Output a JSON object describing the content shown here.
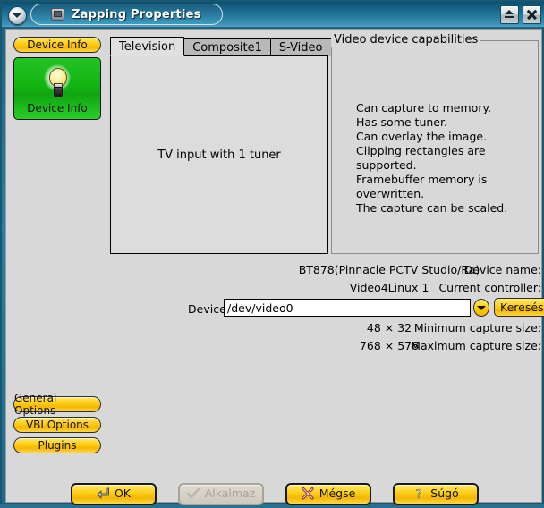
{
  "window": {
    "title": "Zapping Properties",
    "menu_icon": "chevron-down-icon",
    "app_icon": "tv-device-icon",
    "shade_button": "shade-icon",
    "close_button": "close-icon"
  },
  "sidebar": {
    "header_label": "Device Info",
    "active_panel": {
      "icon": "lightbulb-icon",
      "label": "Device Info"
    },
    "bottom_items": [
      {
        "label": "General Options"
      },
      {
        "label": "VBI Options"
      },
      {
        "label": "Plugins"
      }
    ]
  },
  "main": {
    "tabs": [
      {
        "label": "Television",
        "active": true
      },
      {
        "label": "Composite1",
        "active": false
      },
      {
        "label": "S-Video",
        "active": false
      }
    ],
    "tab_panel_text": "TV input with 1 tuner",
    "capabilities": {
      "title": "Video device capabilities",
      "lines": [
        "Can capture to memory.",
        "Has some tuner.",
        "Can overlay the image.",
        "Clipping rectangles are supported.",
        "Framebuffer memory is overwritten.",
        "The capture can be scaled."
      ]
    },
    "info": {
      "device_name_label": "Device name:",
      "device_name_value": "BT878(Pinnacle PCTV Studio/Ra)",
      "controller_label": "Current controller:",
      "controller_value": "Video4Linux 1",
      "device_file_label": "Device file:",
      "device_file_value": "/dev/video0",
      "device_file_placeholder": "/dev/video0",
      "browse_label": "Keresés...",
      "dropdown_icon": "chevron-down-icon",
      "min_capture_label": "Minimum capture size:",
      "min_capture_value": "48 × 32",
      "max_capture_label": "Maximum capture size:",
      "max_capture_value": "768 × 576"
    }
  },
  "buttons": [
    {
      "label": "OK",
      "icon": "enter-arrow-icon",
      "disabled": false
    },
    {
      "label": "Alkalmaz",
      "icon": "check-icon",
      "disabled": true
    },
    {
      "label": "Mégse",
      "icon": "x-cross-icon",
      "disabled": false
    },
    {
      "label": "Súgó",
      "icon": "question-mark-icon",
      "disabled": false
    }
  ],
  "colors": {
    "titlebar": "#1c6d92",
    "accent_yellow": "#ffd21e",
    "panel_green": "#13b513",
    "client_bg": "#d8d8d8"
  }
}
